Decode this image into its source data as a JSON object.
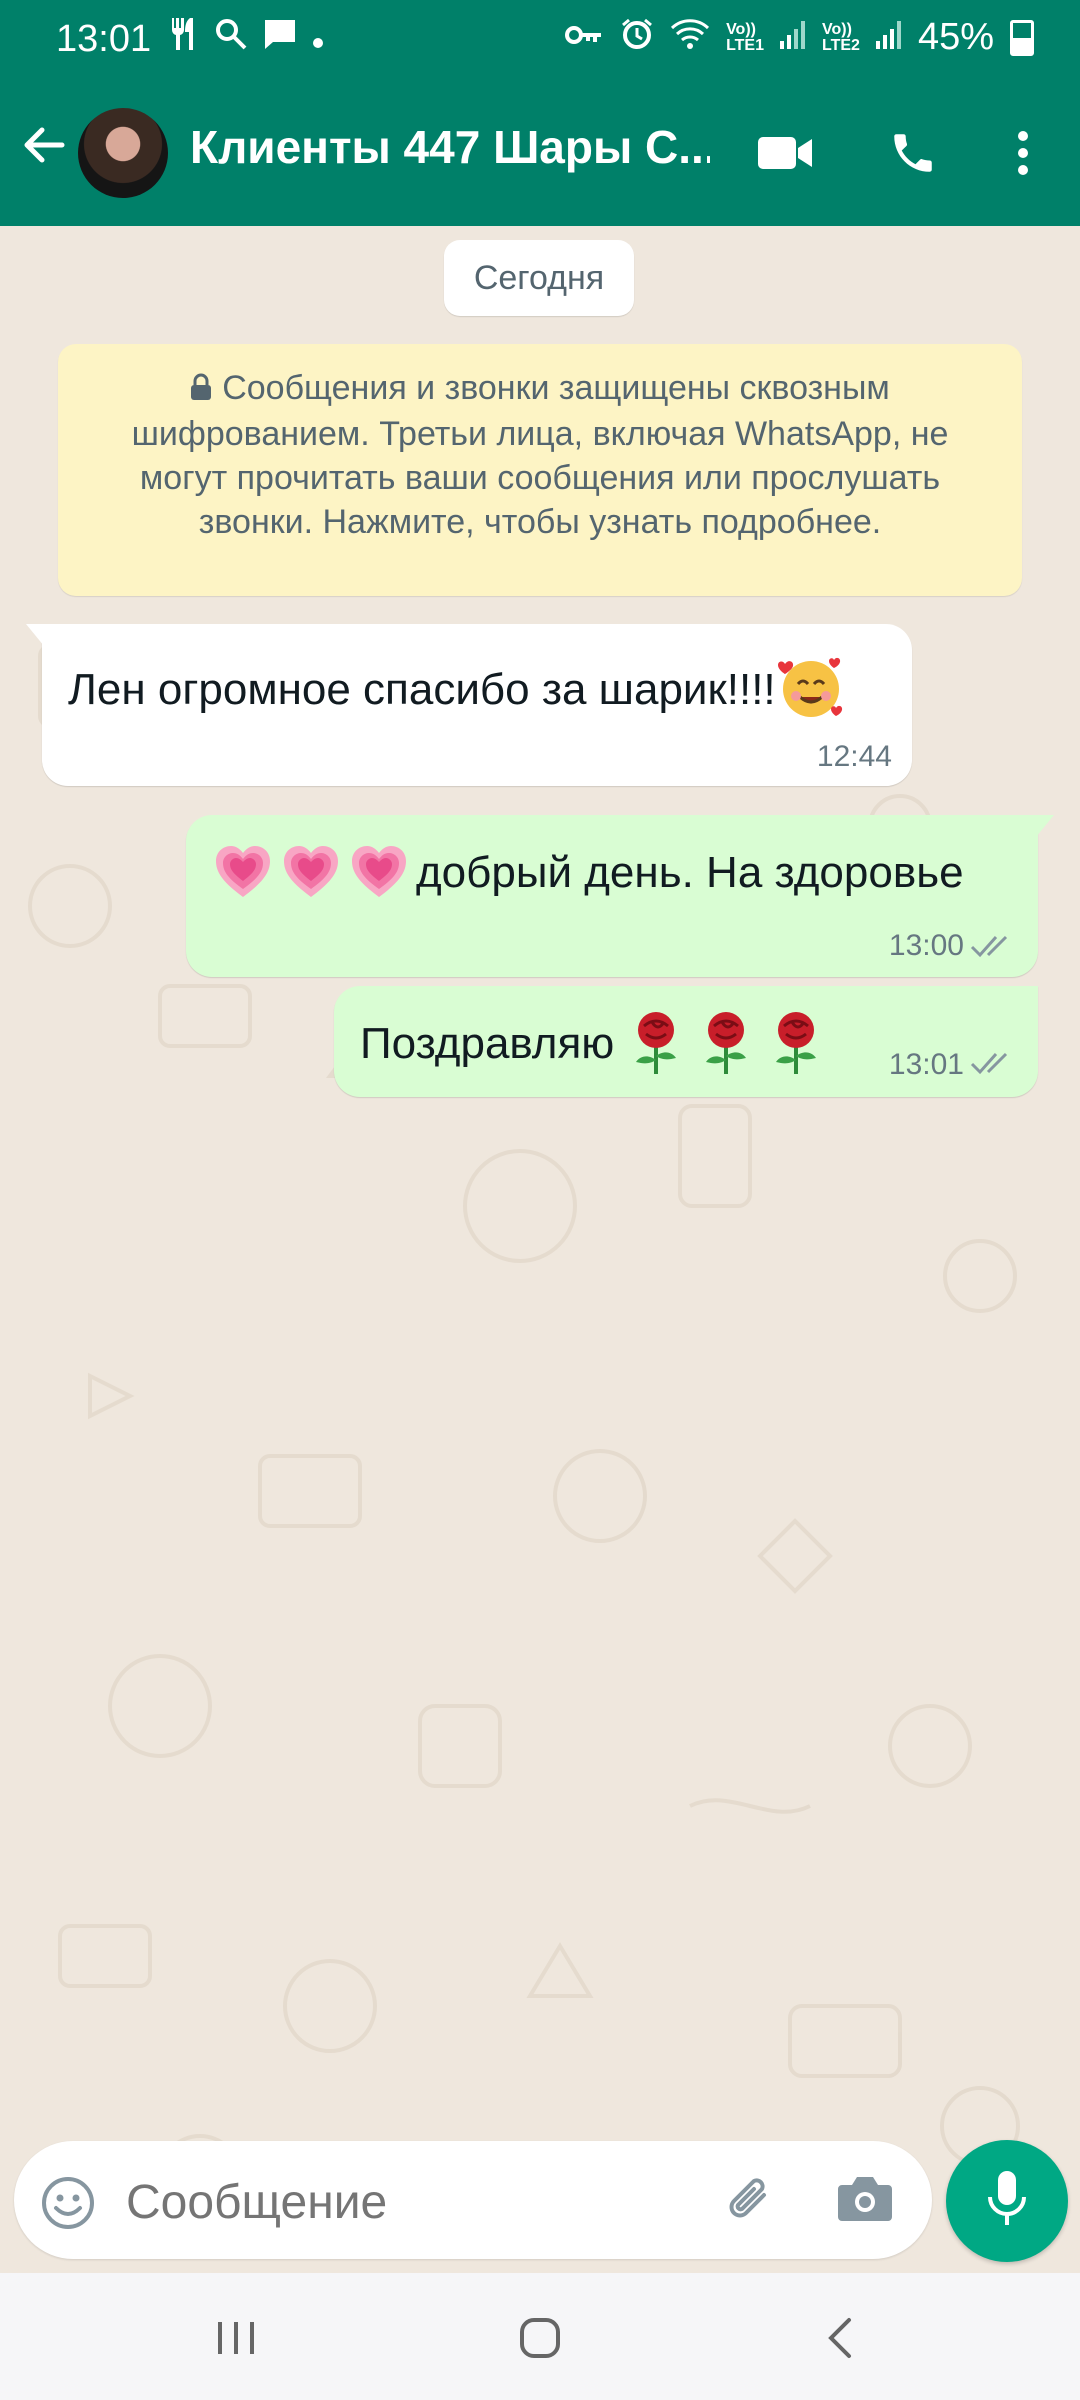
{
  "status_bar": {
    "time": "13:01",
    "sim1": [
      "Vo))",
      "LTE1"
    ],
    "sim2": [
      "Vo))",
      "LTE2"
    ],
    "battery": "45%"
  },
  "header": {
    "title": "Клиенты 447 Шары С...",
    "icons": [
      "back-arrow-icon",
      "video-call-icon",
      "phone-icon",
      "more-vert-icon"
    ]
  },
  "chat": {
    "date_label": "Сегодня",
    "encryption_notice": "Сообщения и звонки защищены сквозным шифрованием. Третьи лица, включая WhatsApp, не могут прочитать ваши сообщения или прослушать звонки. Нажмите, чтобы узнать подробнее.",
    "messages": [
      {
        "direction": "incoming",
        "text": "Лен огромное спасибо за шарик!!!!",
        "emoji": "smiling-face-with-hearts",
        "time": "12:44"
      },
      {
        "direction": "outgoing",
        "text": "добрый день.  На здоровье",
        "emoji_prefix": "growing-heart x3",
        "time": "13:00",
        "status": "delivered"
      },
      {
        "direction": "outgoing",
        "text": "Поздравляю",
        "emoji_suffix": "rose x3",
        "time": "13:01",
        "status": "delivered"
      }
    ]
  },
  "composer": {
    "placeholder": "Сообщение",
    "icons": [
      "emoji-icon",
      "attach-icon",
      "camera-icon",
      "mic-icon"
    ]
  },
  "navbar": {
    "icons": [
      "recent-apps-icon",
      "home-icon",
      "back-icon"
    ]
  },
  "colors": {
    "header": "#008069",
    "outgoing_bubble": "#d9fdd3",
    "incoming_bubble": "#ffffff",
    "notice_bg": "#fdf4c5",
    "mic_button": "#00a884",
    "wallpaper": "#efe7dd"
  }
}
